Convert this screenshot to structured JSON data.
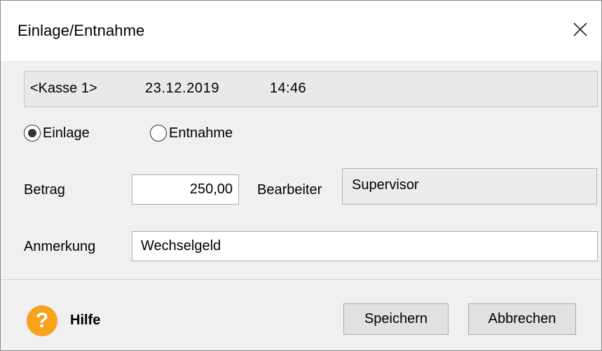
{
  "window": {
    "title": "Einlage/Entnahme"
  },
  "info": {
    "register": "<Kasse 1>",
    "date": "23.12.2019",
    "time": "14:46"
  },
  "transaction_type": {
    "options": [
      {
        "label": "Einlage",
        "selected": true
      },
      {
        "label": "Entnahme",
        "selected": false
      }
    ]
  },
  "form": {
    "amount_label": "Betrag",
    "amount_value": "250,00",
    "operator_label": "Bearbeiter",
    "operator_value": "Supervisor",
    "note_label": "Anmerkung",
    "note_value": "Wechselgeld"
  },
  "footer": {
    "help_icon": "question-icon",
    "help_label": "Hilfe",
    "save_label": "Speichern",
    "cancel_label": "Abbrechen"
  },
  "colors": {
    "help_accent": "#f6a21a",
    "background": "#f0f0f0",
    "titlebar": "#ffffff"
  }
}
